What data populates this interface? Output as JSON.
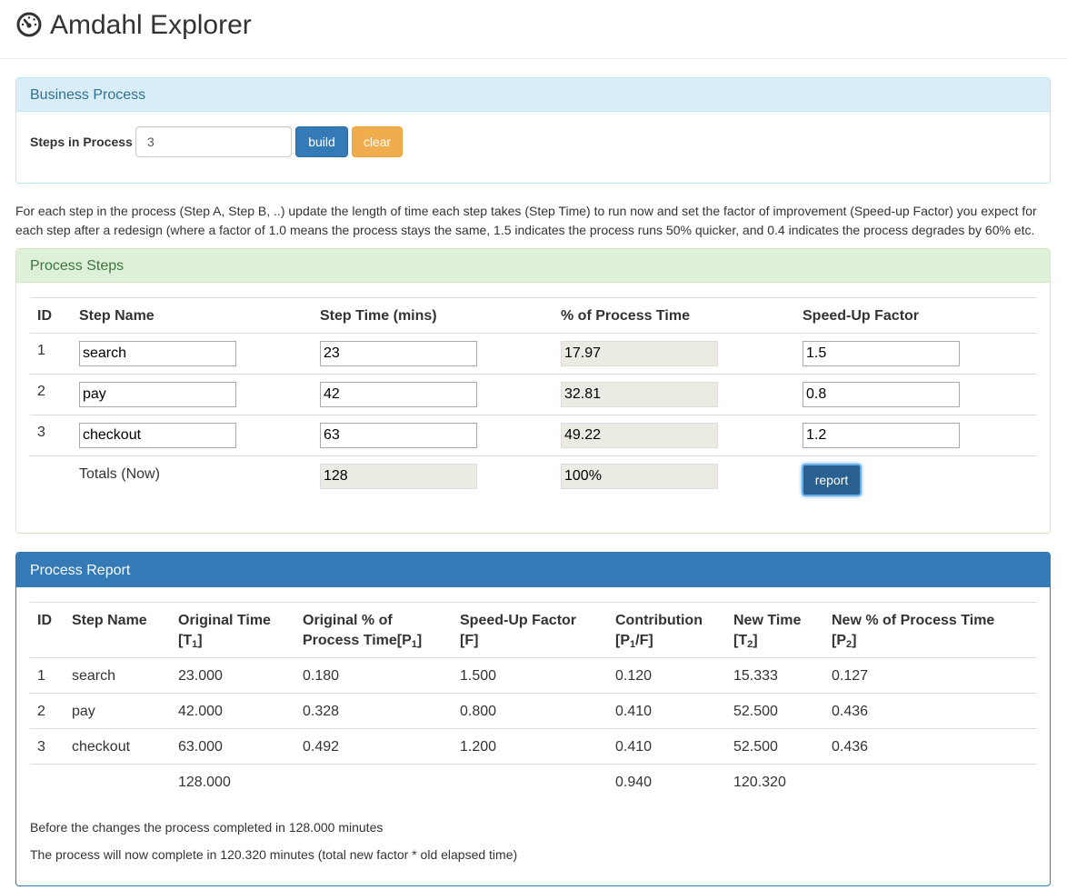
{
  "app": {
    "title": "Amdahl Explorer",
    "icon": "dashboard-gauge-icon"
  },
  "business_process": {
    "heading": "Business Process",
    "steps_label": "Steps in Process",
    "steps_value": "3",
    "build_label": "build",
    "clear_label": "clear"
  },
  "instructions": "For each step in the process (Step A, Step B, ..) update the length of time each step takes (Step Time) to run now and set the factor of improvement (Speed-up Factor) you expect for each step after a redesign (where a factor of 1.0 means the process stays the same, 1.5 indicates the process runs 50% quicker, and 0.4 indicates the process degrades by 60% etc.",
  "process_steps": {
    "heading": "Process Steps",
    "columns": {
      "id": "ID",
      "step_name": "Step Name",
      "step_time": "Step Time (mins)",
      "pct": "% of Process Time",
      "speedup": "Speed-Up Factor"
    },
    "rows": [
      {
        "id": "1",
        "name": "search",
        "time": "23",
        "pct": "17.97",
        "speedup": "1.5"
      },
      {
        "id": "2",
        "name": "pay",
        "time": "42",
        "pct": "32.81",
        "speedup": "0.8"
      },
      {
        "id": "3",
        "name": "checkout",
        "time": "63",
        "pct": "49.22",
        "speedup": "1.2"
      }
    ],
    "totals_label": "Totals (Now)",
    "total_time": "128",
    "total_pct": "100%",
    "report_label": "report"
  },
  "process_report": {
    "heading": "Process Report",
    "columns": {
      "id": "ID",
      "step_name": "Step Name",
      "orig_time_line1": "Original Time",
      "orig_time_sym": "T",
      "orig_time_sub": "1",
      "orig_pct_line1": "Original % of",
      "orig_pct_line2": "Process Time[P",
      "orig_pct_sub": "1",
      "speedup_line1": "Speed-Up Factor",
      "speedup_line2": "[F]",
      "contrib_line1": "Contribution",
      "contrib_sym": "P",
      "contrib_sub": "1",
      "contrib_tail": "/F]",
      "new_time_line1": "New Time",
      "new_time_sym": "T",
      "new_time_sub": "2",
      "new_pct_line1": "New % of Process Time",
      "new_pct_sym": "P",
      "new_pct_sub": "2"
    },
    "rows": [
      {
        "id": "1",
        "name": "search",
        "orig_time": "23.000",
        "orig_pct": "0.180",
        "speedup": "1.500",
        "contrib": "0.120",
        "new_time": "15.333",
        "new_pct": "0.127"
      },
      {
        "id": "2",
        "name": "pay",
        "orig_time": "42.000",
        "orig_pct": "0.328",
        "speedup": "0.800",
        "contrib": "0.410",
        "new_time": "52.500",
        "new_pct": "0.436"
      },
      {
        "id": "3",
        "name": "checkout",
        "orig_time": "63.000",
        "orig_pct": "0.492",
        "speedup": "1.200",
        "contrib": "0.410",
        "new_time": "52.500",
        "new_pct": "0.436"
      }
    ],
    "totals": {
      "orig_time": "128.000",
      "contrib": "0.940",
      "new_time": "120.320"
    },
    "before_text": "Before the changes the process completed in 128.000 minutes",
    "after_text": "The process will now complete in 120.320 minutes (total new factor * old elapsed time)"
  }
}
